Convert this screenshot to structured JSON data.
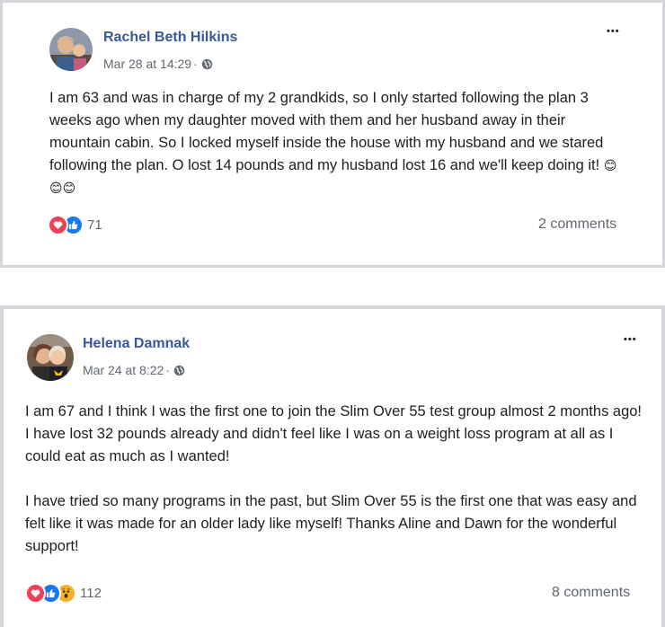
{
  "posts": [
    {
      "author": "Rachel Beth Hilkins",
      "timestamp": "Mar 28 at 14:29",
      "separator": "·",
      "privacy_icon": "globe-icon",
      "more_label": "•••",
      "body": "I am 63 and was in charge of my 2 grandkids, so I only started following the plan 3 weeks ago when my daughter moved with them and her husband away in their mountain cabin. So I locked myself inside the house with my husband and we stared following the plan. O lost 14 pounds and my husband lost 16 and we'll keep doing it!",
      "emojis": "😊😊😊",
      "reactions": [
        "love-icon",
        "like-icon"
      ],
      "reaction_count": "71",
      "comments": "2 comments"
    },
    {
      "author": "Helena Damnak",
      "timestamp": "Mar 24 at 8:22",
      "separator": "·",
      "privacy_icon": "globe-icon",
      "more_label": "•••",
      "body_p1": "I am 67 and I think I was the first one to join the Slim Over 55 test group almost 2 months ago! I have lost 32 pounds already and didn't feel like I was on a weight loss program at all as I could eat as much as I wanted!",
      "body_p2": "I have tried so many programs in the past, but Slim Over 55 is the first one that was easy and felt like it was made for an older lady like myself! Thanks Aline and Dawn for the wonderful support!",
      "reactions": [
        "love-icon",
        "like-icon",
        "wow-icon"
      ],
      "reaction_count": "112",
      "comments": "8 comments"
    }
  ],
  "colors": {
    "author": "#385898",
    "love": "#f33e58",
    "like": "#1877f2",
    "wow": "#f7b125",
    "divider": "#d4d6db"
  }
}
